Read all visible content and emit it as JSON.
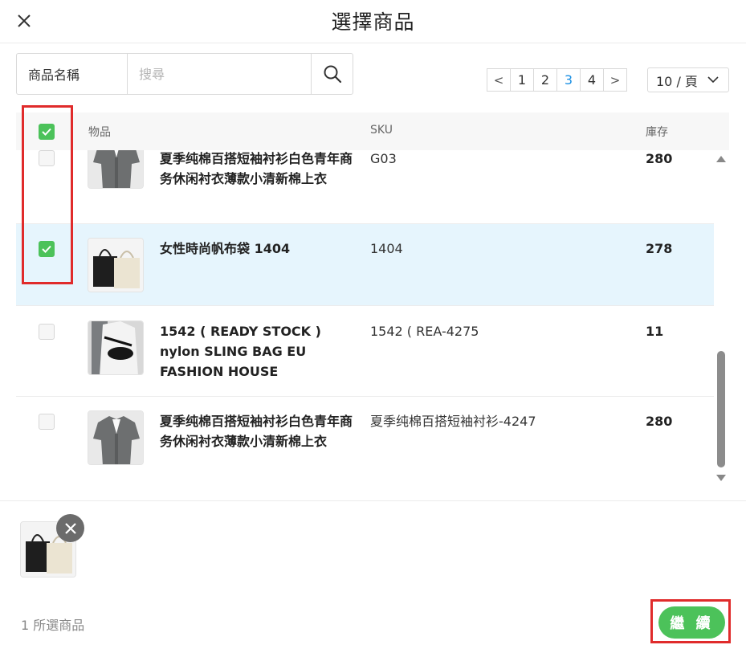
{
  "header": {
    "title": "選擇商品"
  },
  "search": {
    "type_label": "商品名稱",
    "placeholder": "搜尋",
    "value": ""
  },
  "pagination": {
    "prev": "<",
    "next": ">",
    "pages": [
      "1",
      "2",
      "3",
      "4"
    ],
    "current": "3",
    "page_size": "10 / 頁"
  },
  "table": {
    "columns": {
      "item": "物品",
      "sku": "SKU",
      "stock": "庫存"
    },
    "select_all_checked": true,
    "rows": [
      {
        "name": "夏季纯棉百搭短袖衬衫白色青年商务休闲衬衣薄款小清新棉上衣",
        "sku": "G03",
        "stock": "280",
        "checked": false,
        "thumb_icon": "shirt-image"
      },
      {
        "name": "女性時尚帆布袋 1404",
        "sku": "1404",
        "stock": "278",
        "checked": true,
        "thumb_icon": "tote-bag-image"
      },
      {
        "name": "1542 ( READY STOCK ) nylon SLING BAG EU FASHION HOUSE",
        "sku": "1542 ( REA-4275",
        "stock": "11",
        "checked": false,
        "thumb_icon": "sling-bag-image"
      },
      {
        "name": "夏季纯棉百搭短袖衬衫白色青年商务休闲衬衣薄款小清新棉上衣",
        "sku": "夏季纯棉百搭短袖衬衫-4247",
        "stock": "280",
        "checked": false,
        "thumb_icon": "shirt-image"
      }
    ]
  },
  "footer": {
    "selected_count": "1 所選商品",
    "continue_label": "繼 續"
  },
  "colors": {
    "accent_green": "#4cc25a",
    "selected_row": "#e6f5fd",
    "page_active": "#1a8fe3",
    "highlight": "#e02b2b"
  }
}
